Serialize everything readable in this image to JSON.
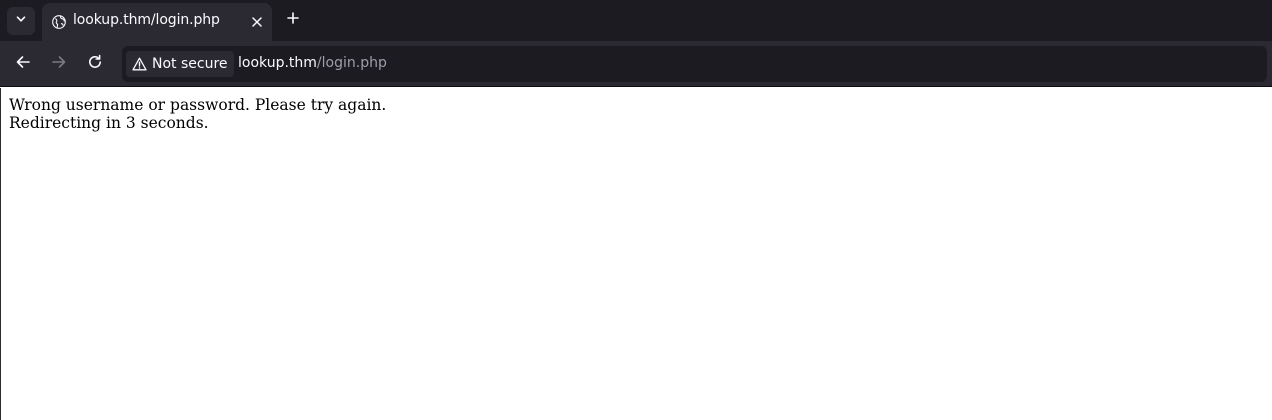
{
  "browser": {
    "tab": {
      "title": "lookup.thm/login.php",
      "favicon": "globe-icon",
      "close": "close-icon"
    },
    "tab_list_icon": "chevron-down-icon",
    "new_tab_icon": "plus-icon",
    "nav": {
      "back_icon": "arrow-left-icon",
      "forward_icon": "arrow-right-icon",
      "reload_icon": "reload-icon"
    },
    "urlbar": {
      "security_label": "Not secure",
      "security_icon": "warning-icon",
      "url_host": "lookup.thm",
      "url_path": "/login.php"
    }
  },
  "page": {
    "message_line1": "Wrong username or password. Please try again.",
    "message_line2": "Redirecting in 3 seconds."
  },
  "colors": {
    "tabstrip_bg": "#1c1b22",
    "toolbar_bg": "#2b2a33",
    "text_light": "#fbfbfe",
    "text_dim": "#9e9ea6",
    "page_bg": "#ffffff"
  }
}
